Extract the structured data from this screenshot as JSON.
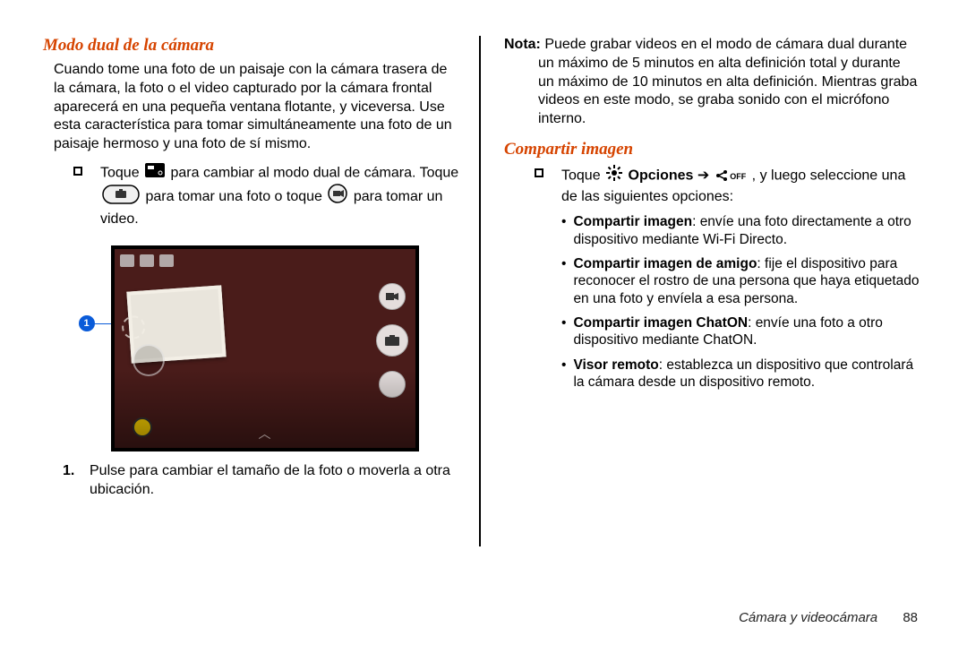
{
  "left": {
    "heading": "Modo dual de la cámara",
    "intro": "Cuando tome una foto de un paisaje con la cámara trasera de la cámara, la foto o el video capturado por la cámara frontal aparecerá en una pequeña ventana flotante, y viceversa. Use esta característica para tomar simultáneamente una foto de un paisaje hermoso y una foto de sí mismo.",
    "bullet_pre": "Toque ",
    "bullet_mid1": " para cambiar al modo dual de cámara. Toque ",
    "bullet_mid2": " para tomar una foto o toque ",
    "bullet_mid3": " para tomar un video.",
    "step1_num": "1.",
    "step1": "Pulse para cambiar el tamaño de la foto o moverla a otra ubicación.",
    "callout": "1"
  },
  "right": {
    "note_label": "Nota:",
    "note_body_first": " Puede grabar videos en el modo de cámara dual durante",
    "note_body_rest": "un máximo de 5 minutos en alta definición total y durante un máximo de 10 minutos en alta definición. Mientras graba videos en este modo, se graba sonido con el micrófono interno.",
    "heading": "Compartir imagen",
    "bullet_pre": "Toque ",
    "opciones": " Opciones ",
    "arrow": "➔",
    "bullet_post": " , y luego seleccione una de las siguientes opciones:",
    "items": [
      {
        "title": "Compartir imagen",
        "text": ": envíe una foto directamente a otro dispositivo mediante Wi-Fi Directo."
      },
      {
        "title": "Compartir imagen de amigo",
        "text": ": fije el dispositivo para reconocer el rostro de una persona que haya etiquetado en una foto y envíela a esa persona."
      },
      {
        "title": "Compartir imagen ChatON",
        "text": ": envíe una foto a otro dispositivo mediante ChatON."
      },
      {
        "title": "Visor remoto",
        "text": ": establezca un dispositivo que controlará la cámara desde un dispositivo remoto."
      }
    ]
  },
  "footer": {
    "section": "Cámara y videocámara",
    "page": "88"
  }
}
